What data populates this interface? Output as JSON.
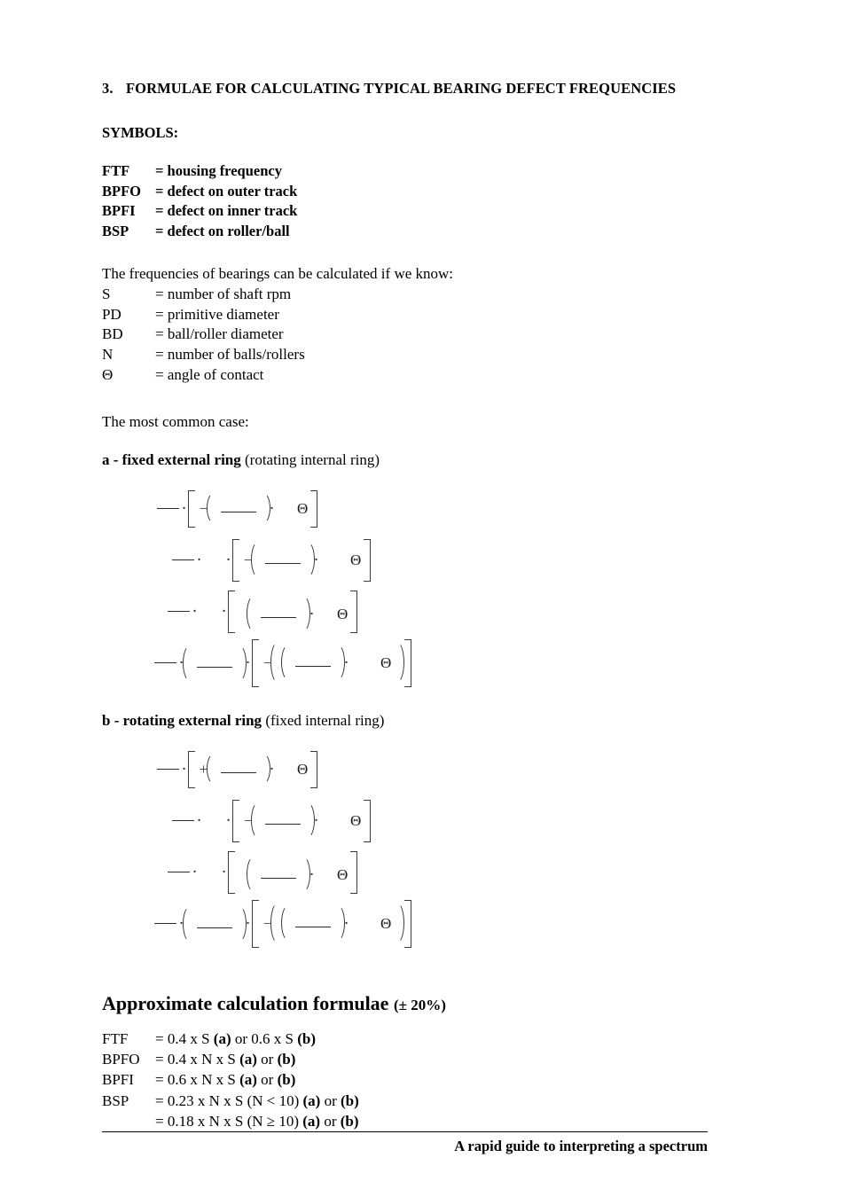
{
  "document": {
    "section": {
      "number": "3.",
      "title": "FORMULAE FOR CALCULATING TYPICAL BEARING DEFECT FREQUENCIES"
    },
    "symbols_heading": "SYMBOLS:",
    "symbol_definitions": [
      {
        "term": "FTF",
        "separator": "=",
        "definition": "housing frequency"
      },
      {
        "term": "BPFO",
        "separator": "=",
        "definition": "defect on outer track"
      },
      {
        "term": "BPFI",
        "separator": "=",
        "definition": "defect on inner track"
      },
      {
        "term": "BSP",
        "separator": "=",
        "definition": "defect on roller/ball"
      }
    ],
    "intro_paragraph": "The frequencies of bearings can be calculated if we know:",
    "variable_definitions": [
      {
        "term": "S",
        "separator": "=",
        "definition": "number of shaft rpm"
      },
      {
        "term": "PD",
        "separator": "=",
        "definition": "primitive diameter"
      },
      {
        "term": "BD",
        "separator": "=",
        "definition": "ball/roller diameter"
      },
      {
        "term": "N",
        "separator": "=",
        "definition": "number of balls/rollers"
      },
      {
        "term": "Θ",
        "separator": "=",
        "definition": "angle of contact"
      }
    ],
    "common_case_paragraph": "The most common case:",
    "case_a": {
      "label": "a - fixed external ring",
      "note": "(rotating internal ring)",
      "formula_signs": [
        "−",
        "−",
        "",
        "−"
      ],
      "theta": "Θ"
    },
    "case_b": {
      "label": "b - rotating external ring",
      "note": "(fixed internal ring)",
      "formula_signs": [
        "+",
        "−",
        "",
        "−"
      ],
      "theta": "Θ"
    },
    "approximate": {
      "heading_main": "Approximate calculation formulae",
      "heading_suffix": "(± 20%)",
      "rows": [
        {
          "term": "FTF",
          "text_before": "= 0.4 x S ",
          "tag_a": "(a)",
          "or": " or ",
          "text_mid": "0.6 x S ",
          "tag_b": "(b)"
        },
        {
          "term": "BPFO",
          "text_before": "= 0.4 x N x S ",
          "tag_a": "(a)",
          "or": " or ",
          "text_mid": "",
          "tag_b": "(b)"
        },
        {
          "term": "BPFI",
          "text_before": "= 0.6 x N x S ",
          "tag_a": "(a)",
          "or": " or ",
          "text_mid": "",
          "tag_b": "(b)"
        },
        {
          "term": "BSP",
          "text_before": "= 0.23 x N x S (N < 10) ",
          "tag_a": "(a)",
          "or": " or ",
          "text_mid": "",
          "tag_b": "(b)"
        },
        {
          "term": "",
          "text_before": "= 0.18 x N x S (N ≥ 10) ",
          "tag_a": "(a)",
          "or": " or ",
          "text_mid": "",
          "tag_b": "(b)"
        }
      ]
    },
    "footer": {
      "text": "A rapid guide to interpreting a spectrum"
    }
  }
}
